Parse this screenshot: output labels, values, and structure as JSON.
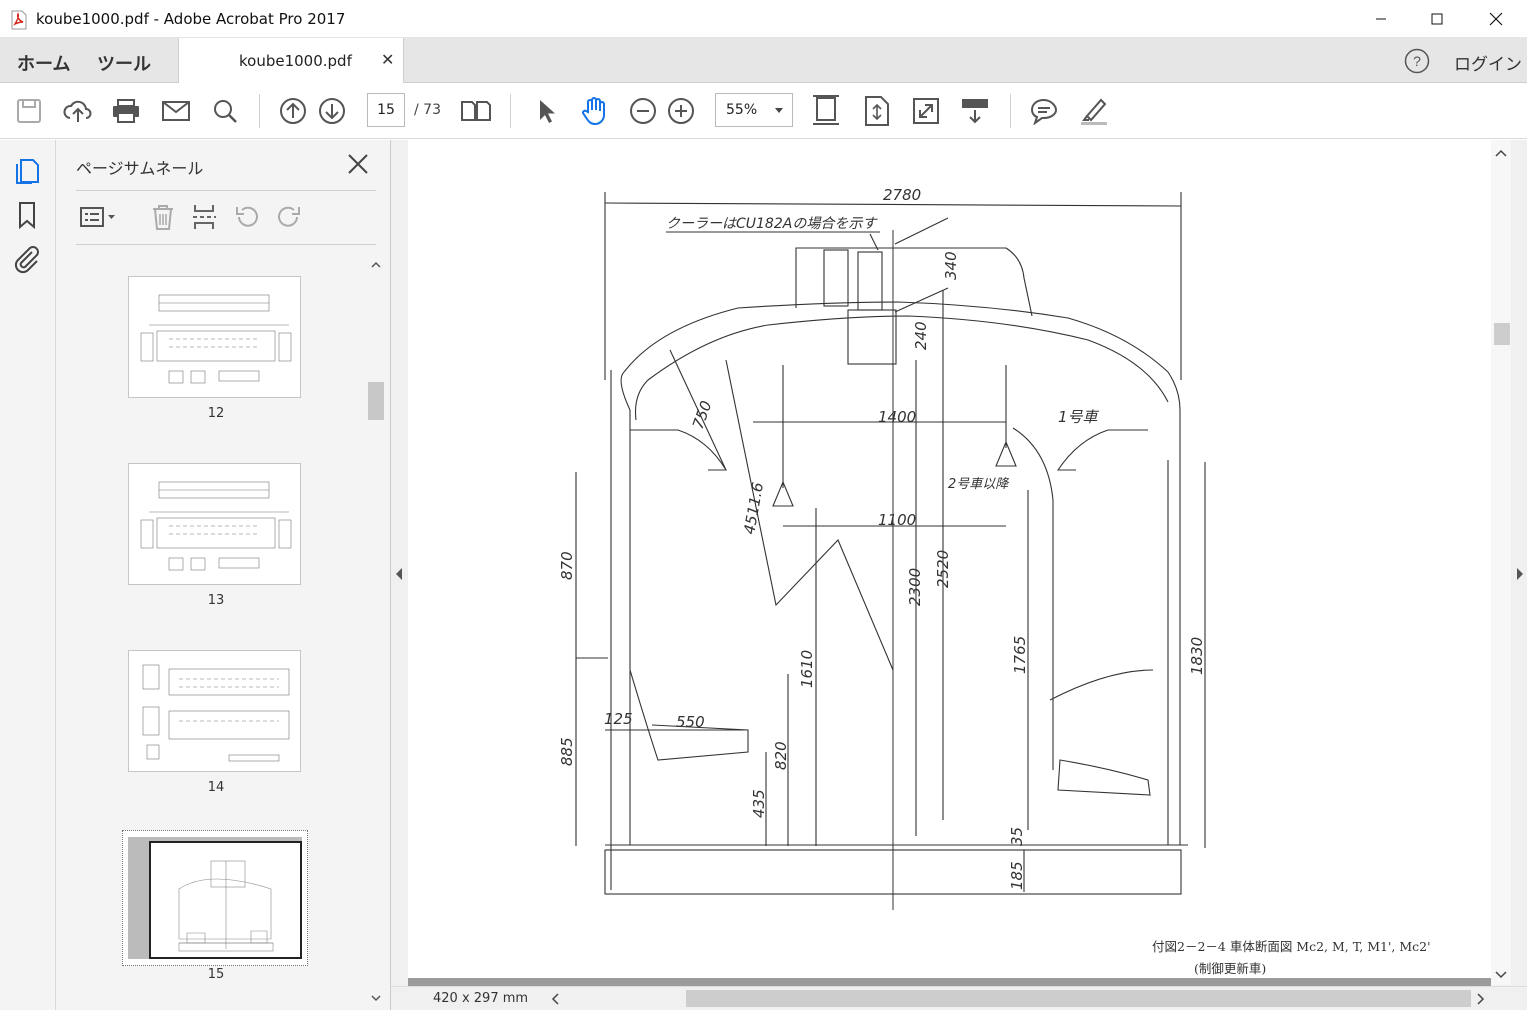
{
  "window": {
    "title": "koube1000.pdf - Adobe Acrobat Pro 2017"
  },
  "tabs": {
    "home": "ホーム",
    "tools": "ツール",
    "document": "koube1000.pdf",
    "login": "ログイン"
  },
  "toolbar": {
    "current_page": "15",
    "total_pages": "/ 73",
    "zoom": "55%"
  },
  "thumbnails_panel": {
    "title": "ページサムネール",
    "pages": [
      {
        "label": "12",
        "selected": false
      },
      {
        "label": "13",
        "selected": false
      },
      {
        "label": "14",
        "selected": false
      },
      {
        "label": "15",
        "selected": true
      }
    ]
  },
  "document": {
    "dimensions": {
      "overall_width": "2780",
      "cooler_note": "クーラーはCU182Aの場合を示す",
      "d340": "340",
      "d240": "240",
      "d750": "750",
      "d1400": "1400",
      "d4511": "4511.6",
      "d1100": "1100",
      "d870": "870",
      "d2300": "2300",
      "d2520": "2520",
      "d1610": "1610",
      "d1765": "1765",
      "d1830": "1830",
      "d125": "125",
      "d550": "550",
      "d885": "885",
      "d820": "820",
      "d435": "435",
      "d35": "35",
      "d185": "185",
      "car1": "1号車",
      "car2": "2号車以降"
    },
    "caption_line1": "付図2－2－4 車体断面図 Mc2, M, T, M1', Mc2'",
    "caption_line2": "(制御更新車)",
    "page_size": "420 x 297 mm"
  },
  "colors": {
    "accent": "#1473e6",
    "panel_bg": "#f4f4f4",
    "tabbar_bg": "#e6e6e6"
  }
}
